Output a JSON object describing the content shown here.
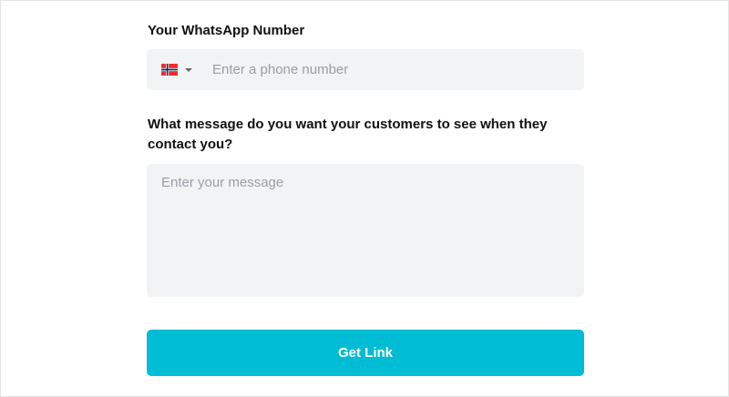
{
  "phone": {
    "label": "Your WhatsApp Number",
    "placeholder": "Enter a phone number",
    "value": "",
    "country_flag": "norway-flag-icon",
    "flag_colors": {
      "red": "#ef2b2d",
      "white": "#ffffff",
      "blue": "#002868"
    }
  },
  "message": {
    "label": "What message do you want your customers to see when they contact you?",
    "placeholder": "Enter your message",
    "value": ""
  },
  "submit": {
    "label": "Get Link",
    "color": "#00bcd4"
  }
}
